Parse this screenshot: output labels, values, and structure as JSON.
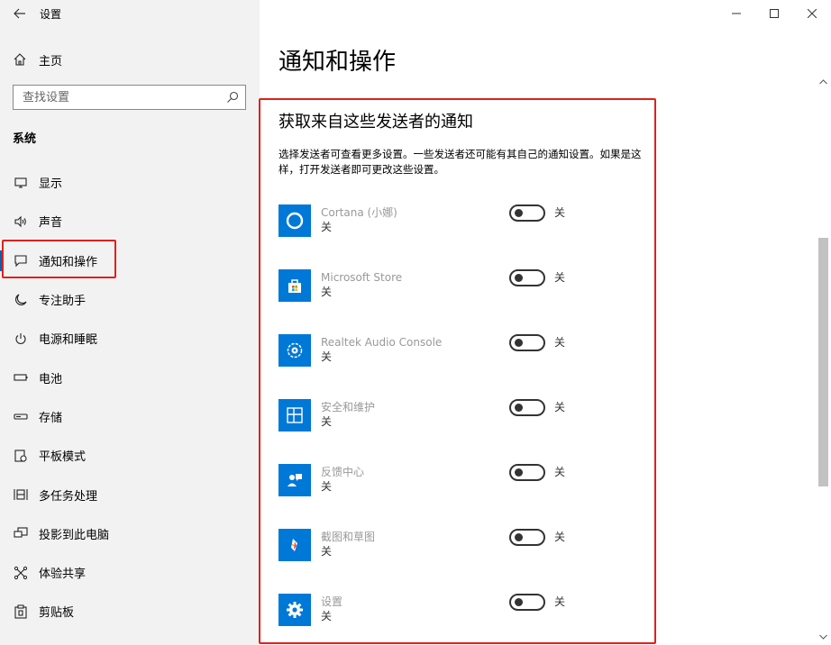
{
  "app": {
    "title": "设置"
  },
  "left": {
    "home_label": "主页",
    "search_placeholder": "查找设置",
    "section": "系统",
    "items": [
      {
        "label": "显示",
        "icon": "monitor-icon"
      },
      {
        "label": "声音",
        "icon": "speaker-icon"
      },
      {
        "label": "通知和操作",
        "icon": "notification-icon",
        "active": true
      },
      {
        "label": "专注助手",
        "icon": "moon-icon"
      },
      {
        "label": "电源和睡眠",
        "icon": "power-icon"
      },
      {
        "label": "电池",
        "icon": "battery-icon"
      },
      {
        "label": "存储",
        "icon": "storage-icon"
      },
      {
        "label": "平板模式",
        "icon": "tablet-icon"
      },
      {
        "label": "多任务处理",
        "icon": "multitask-icon"
      },
      {
        "label": "投影到此电脑",
        "icon": "project-icon"
      },
      {
        "label": "体验共享",
        "icon": "share-icon"
      },
      {
        "label": "剪贴板",
        "icon": "clipboard-icon"
      }
    ]
  },
  "main": {
    "page_title": "通知和操作",
    "section_title": "获取来自这些发送者的通知",
    "section_desc": "选择发送者可查看更多设置。一些发送者还可能有其自己的通知设置。如果是这样，打开发送者即可更改这些设置。",
    "senders": [
      {
        "name": "Cortana (小娜)",
        "state": "关",
        "toggle_label": "关",
        "icon": "cortana-icon"
      },
      {
        "name": "Microsoft Store",
        "state": "关",
        "toggle_label": "关",
        "icon": "store-icon"
      },
      {
        "name": "Realtek Audio Console",
        "state": "关",
        "toggle_label": "关",
        "icon": "realtek-icon"
      },
      {
        "name": "安全和维护",
        "state": "关",
        "toggle_label": "关",
        "icon": "security-icon"
      },
      {
        "name": "反馈中心",
        "state": "关",
        "toggle_label": "关",
        "icon": "feedback-icon"
      },
      {
        "name": "截图和草图",
        "state": "关",
        "toggle_label": "关",
        "icon": "snip-icon"
      },
      {
        "name": "设置",
        "state": "关",
        "toggle_label": "关",
        "icon": "settings-gear-icon"
      }
    ]
  },
  "colors": {
    "accent": "#0078d7",
    "highlight": "#e0201b",
    "active_bar": "#0063b1"
  }
}
